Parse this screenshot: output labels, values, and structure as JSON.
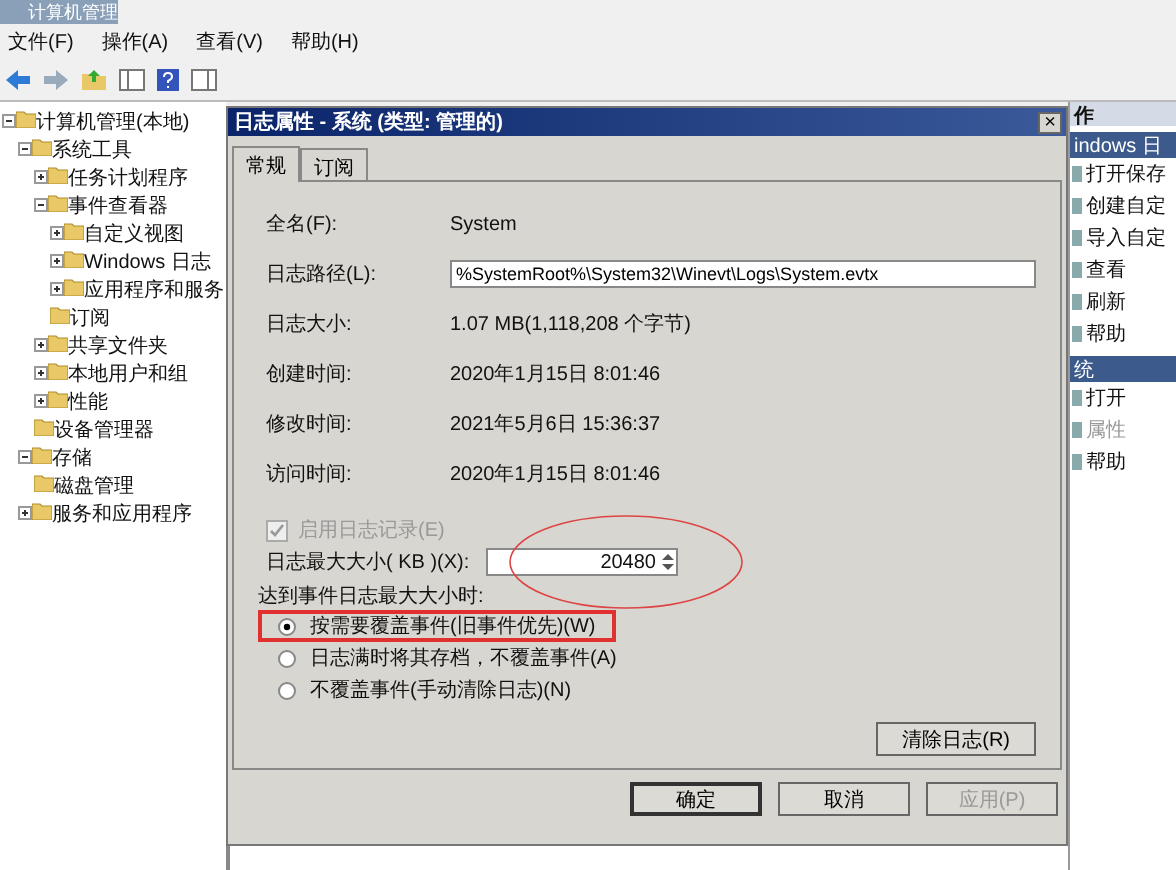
{
  "window": {
    "title": "计算机管理"
  },
  "menu": [
    "文件(F)",
    "操作(A)",
    "查看(V)",
    "帮助(H)"
  ],
  "tree": [
    {
      "label": "计算机管理(本地)",
      "expanded": true,
      "children": [
        {
          "label": "系统工具",
          "expanded": true,
          "children": [
            {
              "label": "任务计划程序",
              "expanded": false
            },
            {
              "label": "事件查看器",
              "expanded": true,
              "children": [
                {
                  "label": "自定义视图",
                  "expanded": false
                },
                {
                  "label": "Windows 日志",
                  "expanded": false
                },
                {
                  "label": "应用程序和服务",
                  "expanded": false
                },
                {
                  "label": "订阅"
                }
              ]
            },
            {
              "label": "共享文件夹",
              "expanded": false
            },
            {
              "label": "本地用户和组",
              "expanded": false
            },
            {
              "label": "性能",
              "expanded": false
            },
            {
              "label": "设备管理器"
            }
          ]
        },
        {
          "label": "存储",
          "expanded": true,
          "children": [
            {
              "label": "磁盘管理"
            }
          ]
        },
        {
          "label": "服务和应用程序",
          "expanded": false
        }
      ]
    }
  ],
  "dialog": {
    "title": "日志属性 - 系统 (类型: 管理的)",
    "close": "×",
    "tabs": [
      {
        "label": "常规",
        "selected": true
      },
      {
        "label": "订阅",
        "selected": false
      }
    ],
    "fields": [
      {
        "label": "全名(F):",
        "value": "System",
        "kind": "text"
      },
      {
        "label": "日志路径(L):",
        "value": "%SystemRoot%\\System32\\Winevt\\Logs\\System.evtx",
        "kind": "input"
      },
      {
        "label": "日志大小:",
        "value": "1.07 MB(1,118,208 个字节)",
        "kind": "text"
      },
      {
        "label": "创建时间:",
        "value": "2020年1月15日 8:01:46",
        "kind": "text"
      },
      {
        "label": "修改时间:",
        "value": "2021年5月6日 15:36:37",
        "kind": "text"
      },
      {
        "label": "访问时间:",
        "value": "2020年1月15日 8:01:46",
        "kind": "text"
      }
    ],
    "enable_logging": {
      "label": "启用日志记录(E)",
      "checked": true,
      "disabled": true
    },
    "max_size": {
      "label": "日志最大大小( KB )(X):",
      "value": "20480",
      "circled": true
    },
    "policy_label": "达到事件日志最大大小时:",
    "policies": [
      {
        "label": "按需要覆盖事件(旧事件优先)(W)",
        "selected": true,
        "highlighted": true
      },
      {
        "label": "日志满时将其存档，不覆盖事件(A)",
        "selected": false,
        "highlighted": false
      },
      {
        "label": "不覆盖事件(手动清除日志)(N)",
        "selected": false,
        "highlighted": false
      }
    ],
    "clear_button": "清除日志(R)",
    "buttons": [
      {
        "label": "确定",
        "disabled": false
      },
      {
        "label": "取消",
        "disabled": false
      },
      {
        "label": "应用(P)",
        "disabled": true
      }
    ]
  },
  "actions": {
    "title": "作",
    "sections": [
      {
        "title": "indows 日",
        "items": [
          {
            "label": "打开保存",
            "disabled": false
          },
          {
            "label": "创建自定",
            "disabled": false
          },
          {
            "label": "导入自定",
            "disabled": false
          },
          {
            "label": "查看",
            "disabled": false
          },
          {
            "label": "刷新",
            "disabled": false
          },
          {
            "label": "帮助",
            "disabled": false
          }
        ]
      },
      {
        "title": "统",
        "items": [
          {
            "label": "打开",
            "disabled": false
          },
          {
            "label": "属性",
            "disabled": true
          },
          {
            "label": "帮助",
            "disabled": false
          }
        ]
      }
    ]
  }
}
